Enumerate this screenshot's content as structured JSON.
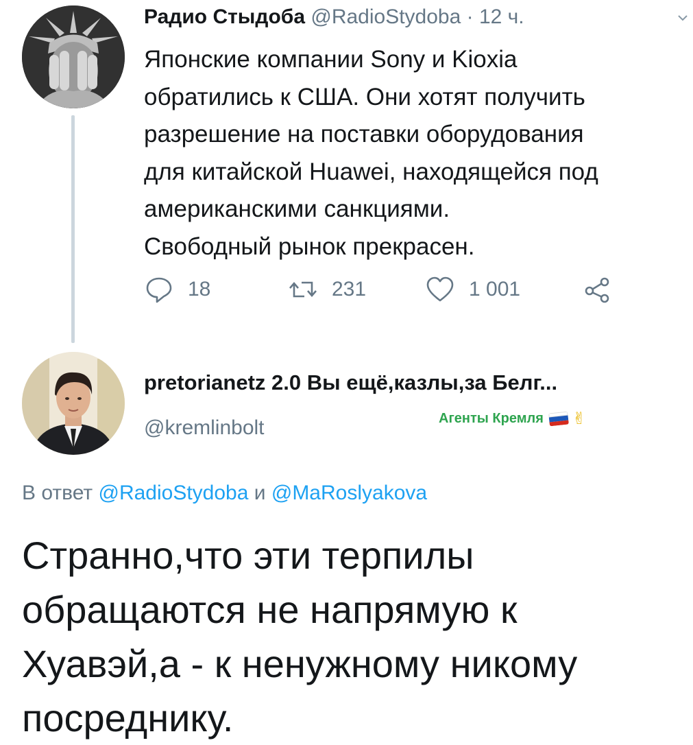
{
  "tweet": {
    "author_name": "Радио Стыдоба",
    "author_handle": "@RadioStydoba",
    "separator": "·",
    "time": "12 ч.",
    "lines": [
      "Японские компании Sony и Kioxia",
      "обратились к США. Они хотят получить",
      "разрешение на поставки оборудования",
      "для китайской Huawei, находящейся под",
      "американскими санкциями.",
      "Свободный рынок прекрасен."
    ],
    "actions": {
      "reply_count": "18",
      "retweet_count": "231",
      "like_count": "1 001"
    },
    "icons": {
      "more": "chevron-down-icon",
      "reply": "comment-icon",
      "retweet": "retweet-icon",
      "like": "heart-icon",
      "share": "share-icon"
    }
  },
  "reply": {
    "author_name": "pretorianetz 2.0 Вы ещё,казлы,за Белг...",
    "author_handle": "@kremlinbolt",
    "badge_text": "Агенты Кремля",
    "badge_color": "#2ea44f",
    "badge_emoji": "✌",
    "in_reply_prefix": "В ответ",
    "in_reply_mention1": "@RadioStydoba",
    "in_reply_and": "и",
    "in_reply_mention2": "@MaRoslyakova",
    "lines": [
      "Странно,что эти терпилы",
      "обращаются не напрямую к",
      "Хуавэй,а - к ненужному никому",
      "посреднику."
    ]
  },
  "colors": {
    "text": "#14171a",
    "muted": "#657786",
    "link": "#1da1f2",
    "thread_line": "#ccd6dd"
  }
}
